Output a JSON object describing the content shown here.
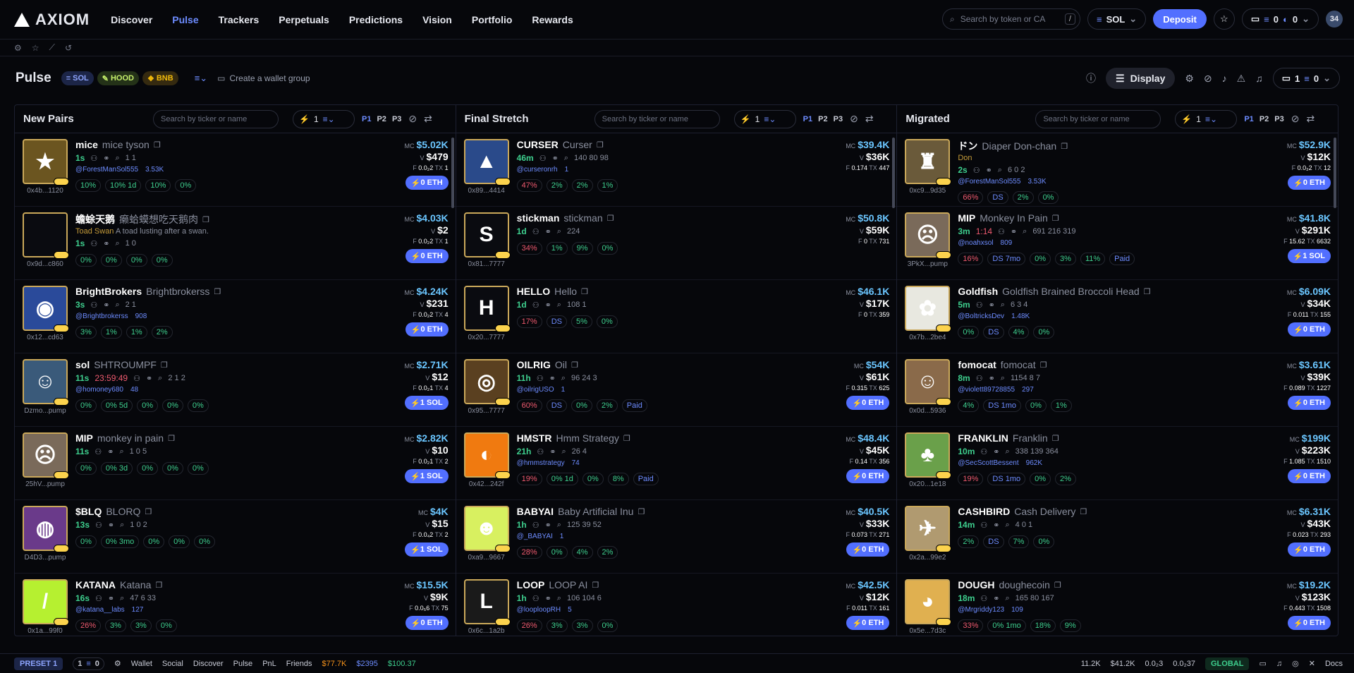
{
  "brand": "AXIOM",
  "nav": [
    "Discover",
    "Pulse",
    "Trackers",
    "Perpetuals",
    "Predictions",
    "Vision",
    "Portfolio",
    "Rewards"
  ],
  "nav_active": "Pulse",
  "search": {
    "placeholder": "Search by token or CA",
    "kbd": "/"
  },
  "chain": "SOL",
  "deposit": "Deposit",
  "wallet": {
    "a": "0",
    "b": "0"
  },
  "user_initials": "34",
  "page": {
    "title": "Pulse",
    "chips": [
      "SOL",
      "HOOD",
      "BNB"
    ],
    "group": "Create a wallet group",
    "display": "Display",
    "walletcount": "1",
    "balance": "0"
  },
  "columns": [
    {
      "title": "New Pairs",
      "search": "Search by ticker or name",
      "qty": "1",
      "presets": [
        "P1",
        "P2",
        "P3"
      ],
      "rows": [
        {
          "sym": "mice",
          "name": "mice tyson",
          "age": "1s",
          "stats": "1   1",
          "handle": "@ForestManSol555",
          "f2": "3.53K",
          "addr": "0x4b...1120",
          "mc": "$5.02K",
          "v": "$479",
          "f": "0.0₂2",
          "tx": "1",
          "buy": "0 ETH",
          "b": [
            "10%",
            "10% 1d",
            "10%",
            "0%"
          ],
          "bg": "#6b5520",
          "ch": "★"
        },
        {
          "sym": "蟾蜍天鹅",
          "name": "癞蛤蟆想吃天鹅肉",
          "desc": "Toad Swan",
          "desc2": "A toad lusting after a swan.",
          "age": "1s",
          "stats": "1   0",
          "handle": "",
          "f2": "",
          "addr": "0x9d...c860",
          "mc": "$4.03K",
          "v": "$2",
          "f": "0.0₂2",
          "tx": "1",
          "buy": "0 ETH",
          "b": [
            "0%",
            "0%",
            "0%",
            "0%"
          ],
          "bg": "#0a0b10",
          "ch": ""
        },
        {
          "sym": "BrightBrokers",
          "name": "Brightbrokerss",
          "age": "3s",
          "stats": "2   1",
          "handle": "@Brightbrokerss",
          "f2": "908",
          "addr": "0x12...cd63",
          "mc": "$4.24K",
          "v": "$231",
          "f": "0.0₂2",
          "tx": "4",
          "buy": "0 ETH",
          "b": [
            "3%",
            "1%",
            "1%",
            "2%"
          ],
          "bg": "#2a4a9a",
          "ch": "◉"
        },
        {
          "sym": "sol",
          "name": "SHTROUMPF",
          "age": "11s",
          "timer": "23:59:49",
          "stats": "2  1  2",
          "handle": "@homoney680",
          "f2": "48",
          "addr": "Dzmo...pump",
          "mc": "$2.71K",
          "v": "$12",
          "f": "0.0₂1",
          "tx": "4",
          "buy": "1 SOL",
          "b": [
            "0%",
            "0% 5d",
            "0%",
            "0%",
            "0%"
          ],
          "bg": "#3a5a7a",
          "ch": "☺"
        },
        {
          "sym": "MIP",
          "name": "monkey in pain",
          "age": "11s",
          "stats": "1  0  5",
          "handle": "",
          "f2": "",
          "addr": "25hV...pump",
          "mc": "$2.82K",
          "v": "$10",
          "f": "0.0₂1",
          "tx": "2",
          "buy": "1 SOL",
          "b": [
            "0%",
            "0% 3d",
            "0%",
            "0%",
            "0%"
          ],
          "bg": "#7a6a5a",
          "ch": "☹"
        },
        {
          "sym": "$BLQ",
          "name": "BLORQ",
          "age": "13s",
          "stats": "1  0  2",
          "handle": "",
          "f2": "",
          "addr": "D4D3...pump",
          "mc": "$4K",
          "v": "$15",
          "f": "0.0₄2",
          "tx": "2",
          "buy": "1 SOL",
          "b": [
            "0%",
            "0% 3mo",
            "0%",
            "0%",
            "0%"
          ],
          "bg": "#6a3a8a",
          "ch": "◍"
        },
        {
          "sym": "KATANA",
          "name": "Katana",
          "age": "16s",
          "stats": "47  6  33",
          "handle": "@katana__labs",
          "f2": "127",
          "addr": "0x1a...99f0",
          "mc": "$15.5K",
          "v": "$9K",
          "f": "0.0₅6",
          "tx": "75",
          "buy": "0 ETH",
          "b": [
            "26%",
            "3%",
            "3%",
            "0%"
          ],
          "bg": "#b6f030",
          "ch": "/"
        }
      ]
    },
    {
      "title": "Final Stretch",
      "search": "Search by ticker or name",
      "qty": "1",
      "presets": [
        "P1",
        "P2",
        "P3"
      ],
      "rows": [
        {
          "sym": "CURSER",
          "name": "Curser",
          "age": "46m",
          "stats": "140  80  98",
          "handle": "@curseronrh",
          "f2": "1",
          "addr": "0x89...4414",
          "mc": "$39.4K",
          "v": "$36K",
          "f": "0.174",
          "tx": "447",
          "buy": "",
          "b": [
            "47%",
            "2%",
            "2%",
            "1%"
          ],
          "bg": "#2a4a8a",
          "ch": "▲"
        },
        {
          "sym": "stickman",
          "name": "stickman",
          "age": "1d",
          "stats": "224",
          "handle": "",
          "f2": "",
          "addr": "0x81...7777",
          "mc": "$50.8K",
          "v": "$59K",
          "f": "0",
          "tx": "731",
          "buy": "",
          "b": [
            "34%",
            "1%",
            "9%",
            "0%"
          ],
          "bg": "#0a0b10",
          "ch": "S"
        },
        {
          "sym": "HELLO",
          "name": "Hello",
          "age": "1d",
          "stats": "108  1",
          "handle": "",
          "f2": "",
          "addr": "0x20...7777",
          "mc": "$46.1K",
          "v": "$17K",
          "f": "0",
          "tx": "359",
          "buy": "",
          "b": [
            "17%",
            "DS",
            "5%",
            "0%"
          ],
          "bg": "#0a0b10",
          "ch": "H"
        },
        {
          "sym": "OILRIG",
          "name": "Oil",
          "age": "11h",
          "stats": "96  24  3",
          "handle": "@oilrigUSO",
          "f2": "1",
          "addr": "0x95...7777",
          "mc": "$54K",
          "v": "$61K",
          "f": "0.315",
          "tx": "625",
          "buy": "0 ETH",
          "b": [
            "60%",
            "DS",
            "0%",
            "2%",
            "Paid"
          ],
          "bg": "#5a4020",
          "ch": "◎"
        },
        {
          "sym": "HMSTR",
          "name": "Hmm Strategy",
          "age": "21h",
          "stats": "26  4",
          "handle": "@hmmstrategy",
          "f2": "74",
          "addr": "0x42...242f",
          "mc": "$48.4K",
          "v": "$45K",
          "f": "0.14",
          "tx": "356",
          "buy": "0 ETH",
          "b": [
            "19%",
            "0% 1d",
            "0%",
            "8%",
            "Paid"
          ],
          "bg": "#f07a10",
          "ch": "◐"
        },
        {
          "sym": "BABYAI",
          "name": "Baby Artificial Inu",
          "age": "1h",
          "stats": "125  39  52",
          "handle": "@_BABYAI",
          "f2": "1",
          "addr": "0xa9...9667",
          "mc": "$40.5K",
          "v": "$33K",
          "f": "0.073",
          "tx": "271",
          "buy": "0 ETH",
          "b": [
            "28%",
            "0%",
            "4%",
            "2%"
          ],
          "bg": "#d8f060",
          "ch": "☻"
        },
        {
          "sym": "LOOP",
          "name": "LOOP AI",
          "age": "1h",
          "stats": "106  104  6",
          "handle": "@looploopRH",
          "f2": "5",
          "addr": "0x6c...1a2b",
          "mc": "$42.5K",
          "v": "$12K",
          "f": "0.011",
          "tx": "161",
          "buy": "0 ETH",
          "b": [
            "26%",
            "3%",
            "3%",
            "0%"
          ],
          "bg": "#1a1a1a",
          "ch": "L"
        }
      ]
    },
    {
      "title": "Migrated",
      "search": "Search by ticker or name",
      "qty": "1",
      "presets": [
        "P1",
        "P2",
        "P3"
      ],
      "rows": [
        {
          "sym": "ドン",
          "name": "Diaper Don-chan",
          "desc": "Don",
          "age": "2s",
          "stats": "6  0  2",
          "handle": "@ForestManSol555",
          "f2": "3.53K",
          "addr": "0xc9...9d35",
          "mc": "$52.9K",
          "v": "$12K",
          "f": "0.0₂2",
          "tx": "12",
          "buy": "0 ETH",
          "b": [
            "66%",
            "DS",
            "2%",
            "0%"
          ],
          "bg": "#6a5a3a",
          "ch": "♜"
        },
        {
          "sym": "MIP",
          "name": "Monkey In Pain",
          "age": "3m",
          "timer": "1:14",
          "stats": "691  216  319",
          "handle": "@noahxsol",
          "f2": "809",
          "addr": "3PkX...pump",
          "mc": "$41.8K",
          "v": "$291K",
          "f": "15.62",
          "tx": "6632",
          "buy": "1 SOL",
          "b": [
            "16%",
            "DS 7mo",
            "0%",
            "3%",
            "11%",
            "Paid"
          ],
          "bg": "#7a6a5a",
          "ch": "☹"
        },
        {
          "sym": "Goldfish",
          "name": "Goldfish Brained Broccoli Head",
          "age": "5m",
          "stats": "6  3  4",
          "handle": "@BoltricksDev",
          "f2": "1.48K",
          "addr": "0x7b...2be4",
          "mc": "$6.09K",
          "v": "$34K",
          "f": "0.011",
          "tx": "155",
          "buy": "0 ETH",
          "b": [
            "0%",
            "DS",
            "4%",
            "0%"
          ],
          "bg": "#e8e8e0",
          "ch": "✿"
        },
        {
          "sym": "fomocat",
          "name": "fomocat",
          "age": "8m",
          "stats": "1154  8  7",
          "handle": "@violett89728855",
          "f2": "297",
          "addr": "0x0d...5936",
          "mc": "$3.61K",
          "v": "$39K",
          "f": "0.089",
          "tx": "1227",
          "buy": "0 ETH",
          "b": [
            "4%",
            "DS 1mo",
            "0%",
            "1%"
          ],
          "bg": "#8a6a4a",
          "ch": "☺"
        },
        {
          "sym": "FRANKLIN",
          "name": "Franklin",
          "age": "10m",
          "stats": "338  139  364",
          "handle": "@SecScottBessent",
          "f2": "962K",
          "addr": "0x20...1e18",
          "mc": "$199K",
          "v": "$223K",
          "f": "1.085",
          "tx": "1510",
          "buy": "0 ETH",
          "b": [
            "19%",
            "DS 1mo",
            "0%",
            "2%"
          ],
          "bg": "#6aa04a",
          "ch": "♣"
        },
        {
          "sym": "CASHBIRD",
          "name": "Cash Delivery",
          "age": "14m",
          "stats": "4  0  1",
          "handle": "",
          "f2": "",
          "addr": "0x2a...99e2",
          "mc": "$6.31K",
          "v": "$43K",
          "f": "0.023",
          "tx": "293",
          "buy": "0 ETH",
          "b": [
            "2%",
            "DS",
            "7%",
            "0%"
          ],
          "bg": "#b09a70",
          "ch": "✈"
        },
        {
          "sym": "DOUGH",
          "name": "doughecoin",
          "age": "18m",
          "stats": "165  80  167",
          "handle": "@Mrgriddy123",
          "f2": "109",
          "addr": "0x5e...7d3c",
          "mc": "$19.2K",
          "v": "$123K",
          "f": "0.443",
          "tx": "1508",
          "buy": "0 ETH",
          "b": [
            "33%",
            "0% 1mo",
            "18%",
            "9%"
          ],
          "bg": "#e0b050",
          "ch": "◕"
        }
      ]
    }
  ],
  "footer": {
    "preset": "PRESET 1",
    "wallets": "1",
    "walletbal": "0",
    "items": [
      "Wallet",
      "Social",
      "Discover",
      "Pulse",
      "PnL",
      "Friends"
    ],
    "btc": "$77.7K",
    "eth": "$2395",
    "sol": "$100.37",
    "stats": [
      "11.2K",
      "$41.2K",
      "0.0₂3",
      "0.0₂37"
    ],
    "global": "GLOBAL",
    "docs": "Docs"
  }
}
